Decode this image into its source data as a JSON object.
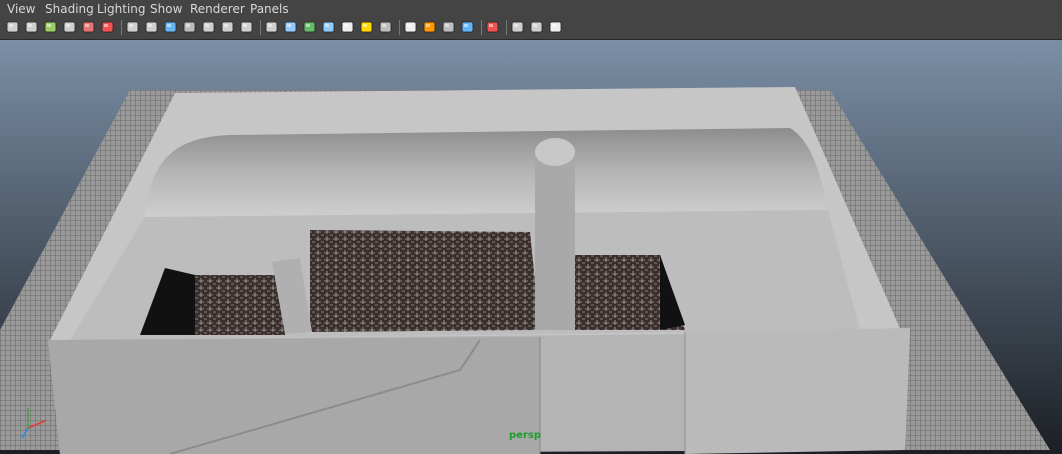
{
  "menu": [
    "View",
    "Shading",
    "Lighting",
    "Show",
    "Renderer",
    "Panels"
  ],
  "toolbar": [
    {
      "name": "select-camera-icon",
      "color": "#cfcfcf"
    },
    {
      "name": "lock-camera-icon",
      "color": "#cfcfcf"
    },
    {
      "name": "camera-attributes-icon",
      "color": "#9ccc65"
    },
    {
      "name": "bookmark-icon",
      "color": "#cfcfcf"
    },
    {
      "name": "image-plane-icon",
      "color": "#e57373"
    },
    {
      "name": "grease-pencil-icon",
      "color": "#ef5350"
    },
    {
      "name": "sep"
    },
    {
      "name": "wireframe-icon",
      "color": "#cfcfcf"
    },
    {
      "name": "grid-icon",
      "color": "#cfcfcf"
    },
    {
      "name": "smooth-shade-icon",
      "color": "#64b5f6"
    },
    {
      "name": "flat-shade-icon",
      "color": "#bdbdbd"
    },
    {
      "name": "bounding-box-icon",
      "color": "#cfcfcf"
    },
    {
      "name": "texture-icon",
      "color": "#cfcfcf"
    },
    {
      "name": "text-icon",
      "color": "#cfcfcf"
    },
    {
      "name": "sep"
    },
    {
      "name": "wireframe-on-shaded-icon",
      "color": "#cfcfcf"
    },
    {
      "name": "xray-icon",
      "color": "#90caf9"
    },
    {
      "name": "xray-joints-icon",
      "color": "#66bb6a"
    },
    {
      "name": "backface-cull-icon",
      "color": "#90caf9"
    },
    {
      "name": "checker-icon",
      "color": "#eeeeee"
    },
    {
      "name": "default-light-icon",
      "color": "#ffd600"
    },
    {
      "name": "all-lights-icon",
      "color": "#bdbdbd"
    },
    {
      "name": "sep"
    },
    {
      "name": "shadows-icon",
      "color": "#eeeeee"
    },
    {
      "name": "ambient-occlusion-icon",
      "color": "#ff9800"
    },
    {
      "name": "motion-blur-icon",
      "color": "#bdbdbd"
    },
    {
      "name": "anti-aliasing-icon",
      "color": "#64b5f6"
    },
    {
      "name": "sep"
    },
    {
      "name": "isolate-select-icon",
      "color": "#ef5350"
    },
    {
      "name": "sep"
    },
    {
      "name": "cube-icon",
      "color": "#cfcfcf"
    },
    {
      "name": "two-pane-icon",
      "color": "#cfcfcf"
    },
    {
      "name": "share-icon",
      "color": "#eeeeee"
    }
  ],
  "viewport": {
    "camera_label": "persp",
    "gradient_top": "#7a8fa6",
    "gradient_bottom": "#1c1f24",
    "model_color": "#b8b8b8",
    "axis_colors": {
      "x": "#e53935",
      "y": "#43a047",
      "z": "#1e88e5"
    }
  }
}
